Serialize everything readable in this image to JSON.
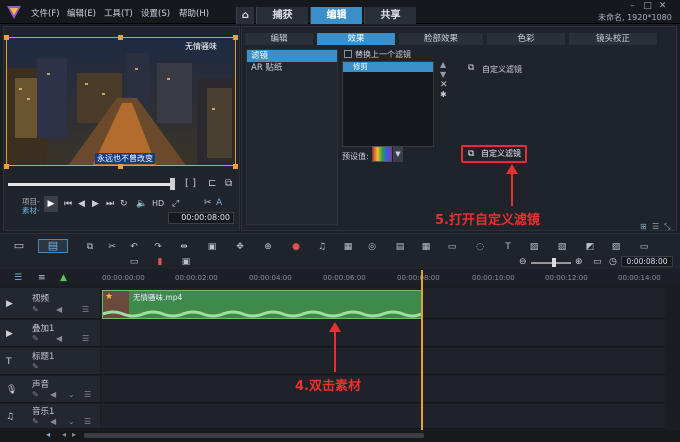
{
  "menu": {
    "file": "文件(F)",
    "edit": "编辑(E)",
    "tools": "工具(T)",
    "settings": "设置(S)",
    "help": "帮助(H)"
  },
  "tabs": [
    "捕获",
    "编辑",
    "共享"
  ],
  "project_info": "未命名, 1920*1080",
  "preview": {
    "watermark": "无情骚味",
    "subtitle": "永远也不曾改变",
    "mode_project": "项目-",
    "mode_clip": "素材-",
    "timecode": "00:00:08:00"
  },
  "options": {
    "tabs": [
      "编辑",
      "效果",
      "脸部效果",
      "色彩",
      "镜头校正"
    ],
    "side_items": [
      "滤镜",
      "AR 贴纸"
    ],
    "replace_last_filter": "替换上一个滤镜",
    "filter_item": "修剪",
    "custom_filter_label": "自定义滤镜",
    "preset_label": "预设值:",
    "custom_filter_button": "自定义滤镜"
  },
  "annotations": {
    "step5": "5.打开自定义滤镜",
    "step4": "4.双击素材"
  },
  "timeline": {
    "zoom_time": "0:00:08:00",
    "ruler": [
      "00:00:00:00",
      "00:00:02:00",
      "00:00:04:00",
      "00:00:06:00",
      "00:00:08:00",
      "00:00:10:00",
      "00:00:12:00",
      "00:00:14:00"
    ],
    "tracks": [
      "视频",
      "叠加1",
      "标题1",
      "声音",
      "音乐1"
    ],
    "clip_name": "无情骚味.mp4"
  },
  "colors": {
    "accent": "#3a8fc8",
    "annotation": "#e83030",
    "clip": "#3d8a4a",
    "playhead": "#e8a030"
  }
}
